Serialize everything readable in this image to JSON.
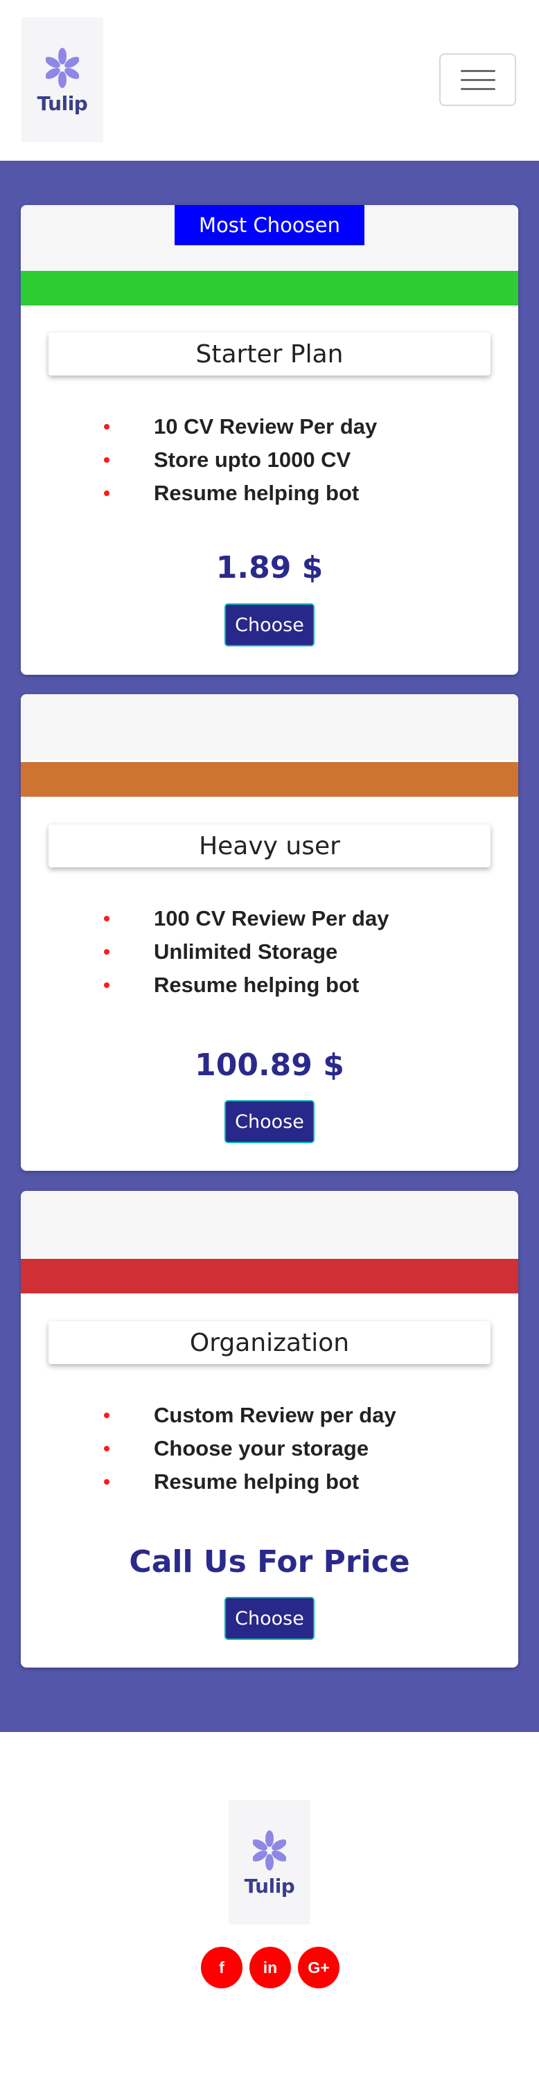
{
  "header": {
    "logo_text": "Tulip",
    "menu_icon": "hamburger-menu-icon"
  },
  "plans": [
    {
      "ribbon": "Most Choosen",
      "stripe_color": "#2ecc33",
      "name": "Starter Plan",
      "features": [
        "10 CV Review Per day",
        "Store upto 1000 CV",
        "Resume helping bot"
      ],
      "price": "1.89 $",
      "button": "Choose"
    },
    {
      "ribbon": "",
      "stripe_color": "#cf7332",
      "name": "Heavy user",
      "features": [
        "100 CV Review Per day",
        "Unlimited Storage",
        "Resume helping bot"
      ],
      "price": "100.89 $",
      "button": "Choose"
    },
    {
      "ribbon": "",
      "stripe_color": "#cf3035",
      "name": "Organization",
      "features": [
        "Custom Review per day",
        "Choose your storage",
        "Resume helping bot"
      ],
      "price": "Call Us For Price",
      "button": "Choose"
    }
  ],
  "footer": {
    "logo_text": "Tulip",
    "socials": [
      {
        "label": "f",
        "icon": "facebook-icon"
      },
      {
        "label": "in",
        "icon": "linkedin-icon"
      },
      {
        "label": "G+",
        "icon": "google-plus-icon"
      }
    ]
  },
  "colors": {
    "band": "#5456aa",
    "ribbon": "#0000ff",
    "button": "#28288a",
    "price": "#2a2a8c",
    "bullet": "#ff1a1a",
    "social": "#ff0000"
  }
}
